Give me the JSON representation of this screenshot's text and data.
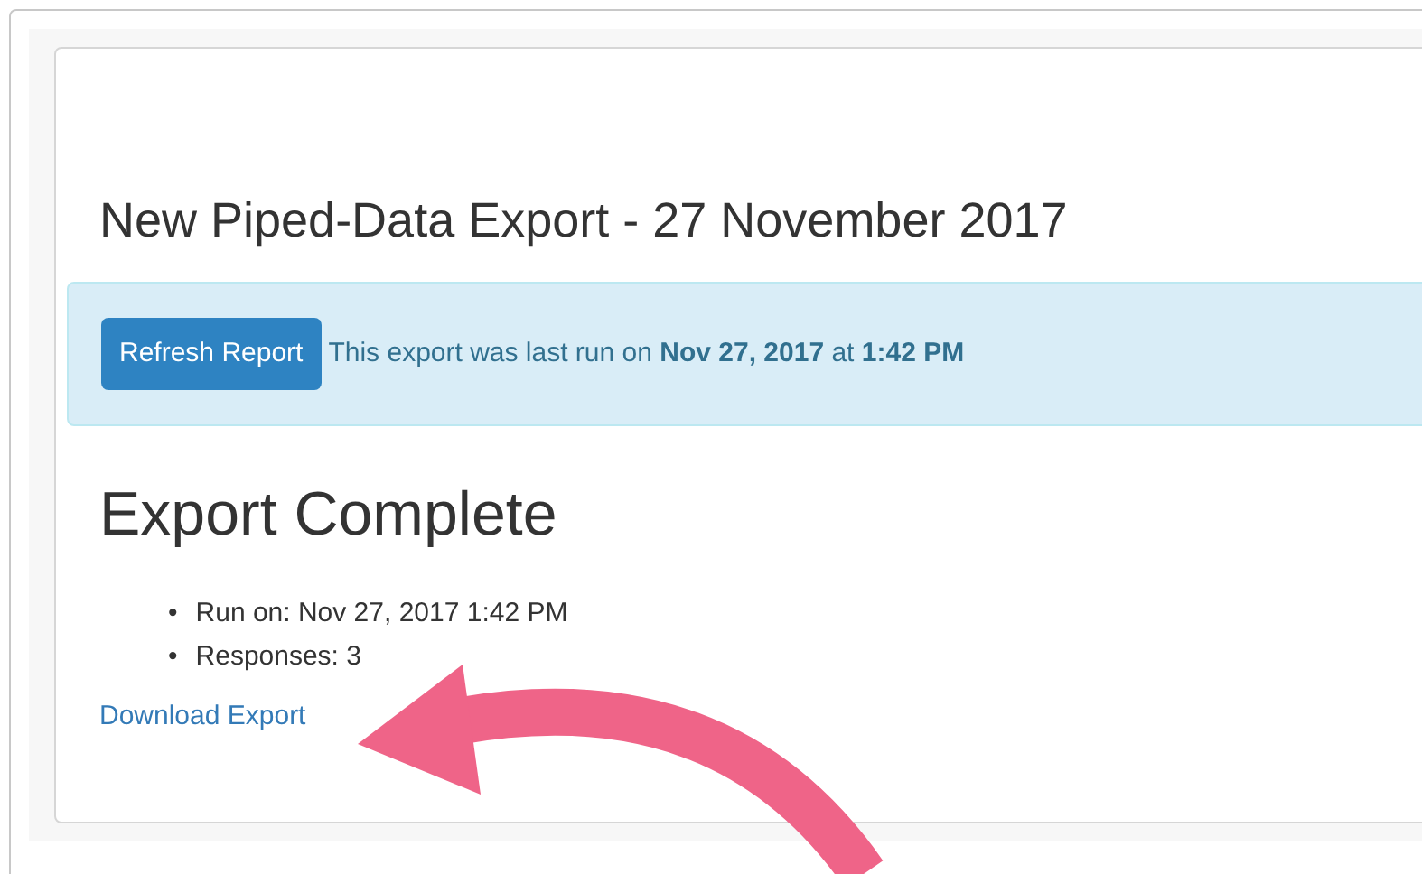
{
  "report": {
    "title": "New Piped-Data Export - 27 November 2017",
    "alert": {
      "button": "Refresh Report",
      "message": "This export was last run on **Nov 27, 2017** at **1:42 PM**"
    },
    "heading": "Export Complete",
    "details": [
      {
        "bullet": "•",
        "text": "Run on: Nov 27, 2017 1:42 PM"
      },
      {
        "bullet": "•",
        "text": "Responses: 3"
      }
    ],
    "link": "Download Export"
  }
}
